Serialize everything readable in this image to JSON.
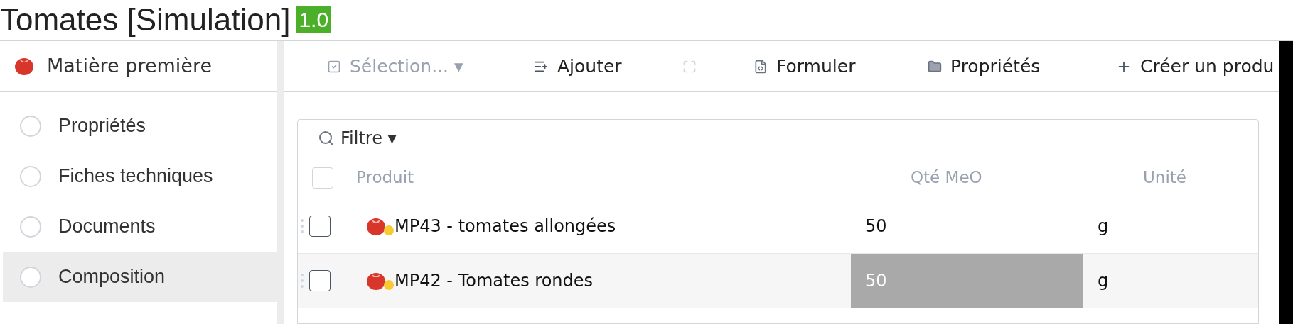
{
  "title": "Tomates [Simulation]",
  "version": "1.0",
  "sidebar": {
    "header": "Matière première",
    "items": [
      {
        "label": "Propriétés",
        "selected": false
      },
      {
        "label": "Fiches techniques",
        "selected": false
      },
      {
        "label": "Documents",
        "selected": false
      },
      {
        "label": "Composition",
        "selected": true
      }
    ]
  },
  "toolbar": [
    {
      "kind": "select",
      "label": "Sélection... ▾",
      "disabled": true
    },
    {
      "kind": "add",
      "label": "Ajouter",
      "disabled": false
    },
    {
      "kind": "expand",
      "disabled": true
    },
    {
      "kind": "formula",
      "label": "Formuler",
      "disabled": false
    },
    {
      "kind": "properties",
      "label": "Propriétés",
      "disabled": false
    },
    {
      "kind": "create",
      "label": "Créer un produ",
      "disabled": false
    }
  ],
  "filter": {
    "label": "Filtre ▾"
  },
  "table": {
    "select_all_checked": false,
    "columns": [
      "Produit",
      "Qté MeO",
      "Unité"
    ],
    "rows": [
      {
        "product": "MP43 - tomates allongées",
        "qty": "50",
        "unit": "g",
        "checked": false,
        "selected": false
      },
      {
        "product": "MP42 - Tomates rondes",
        "qty": "50",
        "unit": "g",
        "checked": false,
        "selected": true
      }
    ]
  }
}
